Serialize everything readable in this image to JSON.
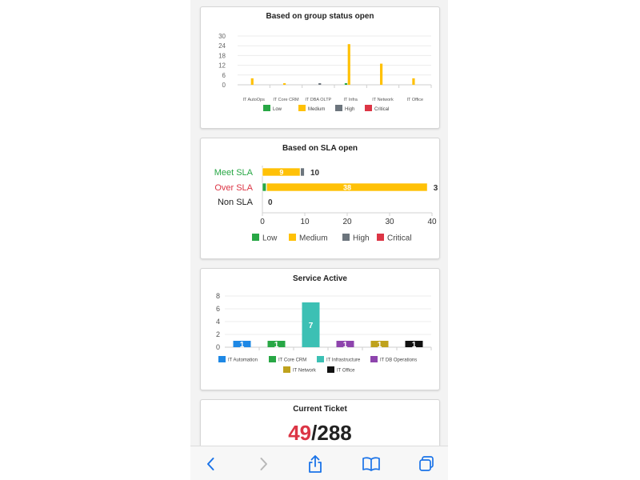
{
  "cards": {
    "group_status": {
      "title": "Based on group status open",
      "chart_data": {
        "type": "bar",
        "title": "Based on group status open",
        "categories": [
          "IT AutoOps",
          "IT Core CRM",
          "IT DBA OLTP",
          "IT Infra",
          "IT Network",
          "IT Office"
        ],
        "series": [
          {
            "name": "Low",
            "color": "#28a745",
            "values": [
              0,
              0,
              0,
              1,
              0,
              0
            ]
          },
          {
            "name": "Medium",
            "color": "#ffc107",
            "values": [
              4,
              1,
              0,
              25,
              13,
              4
            ]
          },
          {
            "name": "High",
            "color": "#6c757d",
            "values": [
              0,
              0,
              1,
              0,
              0,
              0
            ]
          },
          {
            "name": "Critical",
            "color": "#dc3545",
            "values": [
              0,
              0,
              0,
              0,
              0,
              0
            ]
          }
        ],
        "ylim": [
          0,
          30
        ],
        "yticks": [
          0,
          6,
          12,
          18,
          24,
          30
        ],
        "grid": true,
        "legend": "bottom"
      }
    },
    "sla": {
      "title": "Based on SLA open",
      "chart_data": {
        "type": "bar",
        "orientation": "horizontal",
        "title": "Based on SLA open",
        "categories": [
          "Meet SLA",
          "Over SLA",
          "Non SLA"
        ],
        "category_colors": [
          "#28a745",
          "#dc3545",
          "#222222"
        ],
        "series": [
          {
            "name": "Low",
            "color": "#28a745",
            "values": [
              0,
              1,
              0
            ]
          },
          {
            "name": "Medium",
            "color": "#ffc107",
            "values": [
              9,
              38,
              0
            ]
          },
          {
            "name": "High",
            "color": "#6c757d",
            "values": [
              1,
              0,
              0
            ]
          },
          {
            "name": "Critical",
            "color": "#dc3545",
            "values": [
              0,
              0,
              0
            ]
          }
        ],
        "bar_labels": [
          "9",
          "38",
          ""
        ],
        "totals": [
          "10",
          "3",
          "0"
        ],
        "xlim": [
          0,
          40
        ],
        "xticks": [
          0,
          10,
          20,
          30,
          40
        ],
        "legend": "bottom"
      }
    },
    "service": {
      "title": "Service Active",
      "chart_data": {
        "type": "bar",
        "title": "Service Active",
        "categories": [
          "IT Automation",
          "IT Core CRM",
          "IT Infrastructure",
          "IT DB Operations",
          "IT Network",
          "IT Office"
        ],
        "values": [
          1,
          1,
          7,
          1,
          1,
          1
        ],
        "colors": [
          "#1e88e5",
          "#28a745",
          "#3cc0b4",
          "#8e44ad",
          "#bfa21d",
          "#111111"
        ],
        "ylim": [
          0,
          8
        ],
        "yticks": [
          0,
          2,
          4,
          6,
          8
        ],
        "grid": true,
        "legend": "bottom"
      }
    },
    "ticket": {
      "title": "Current Ticket",
      "open": "49",
      "separator": "/",
      "total": "288",
      "open_color": "#dc3545"
    }
  },
  "toolbar": {
    "icons": [
      "back-icon",
      "forward-icon",
      "share-icon",
      "bookmarks-icon",
      "tabs-icon"
    ],
    "accent": "#1a73e8"
  }
}
